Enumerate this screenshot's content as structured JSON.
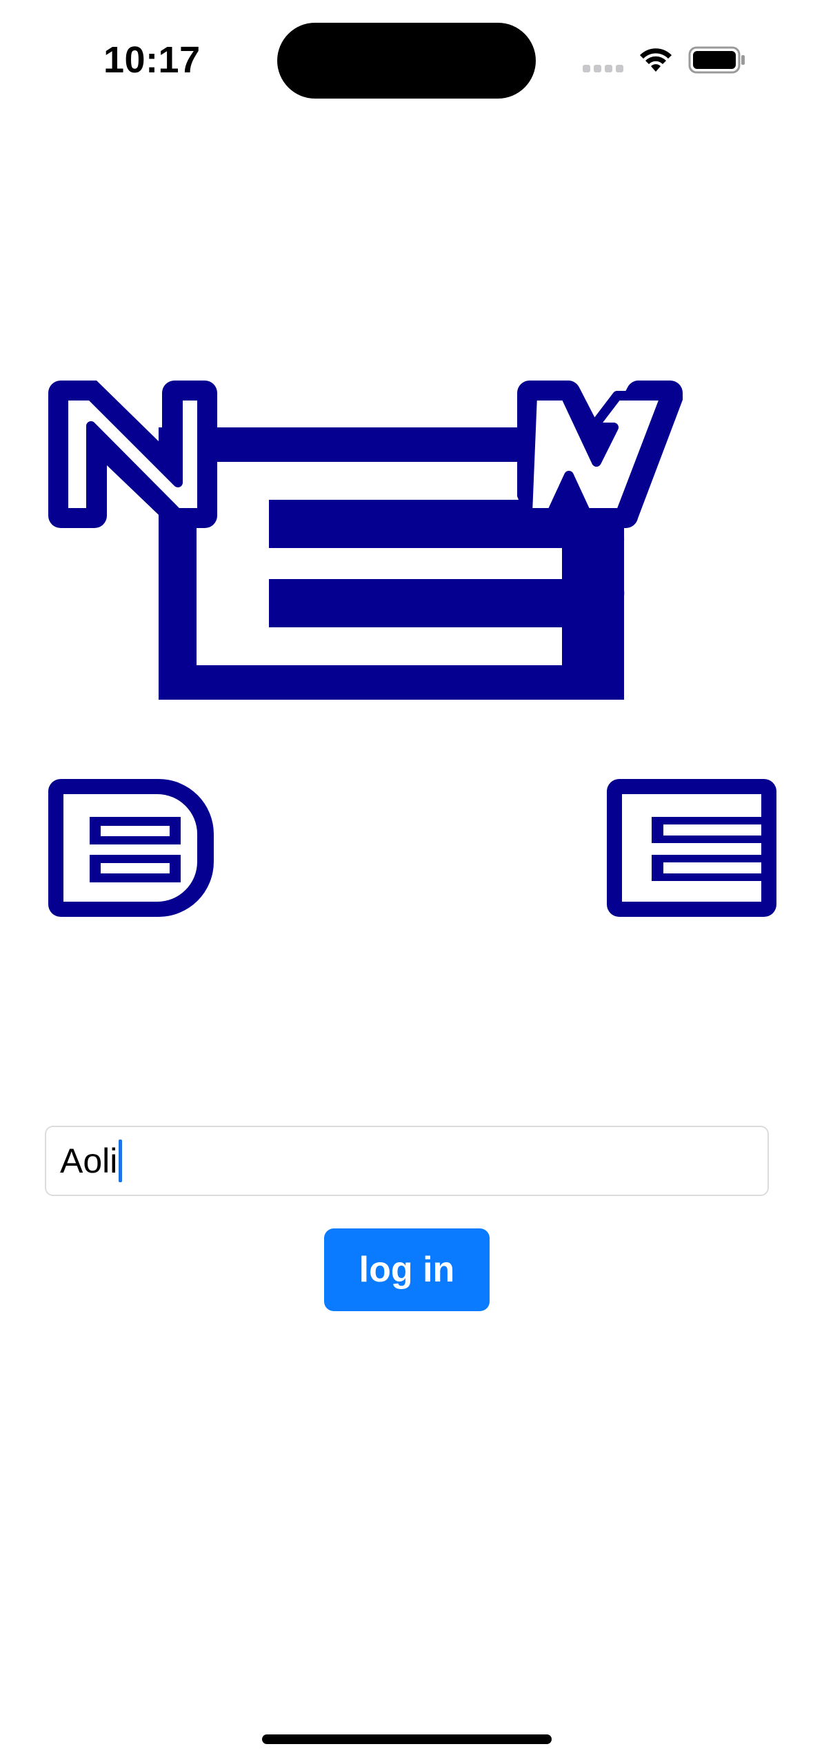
{
  "status_bar": {
    "time": "10:17"
  },
  "logo": {
    "letters": [
      "N",
      "W",
      "B",
      "E"
    ],
    "center_letter": "B",
    "brand_color": "#05008f"
  },
  "login": {
    "name_value": "Aoli",
    "button_label": "log in",
    "button_color": "#0a7bff"
  },
  "icons": {
    "wifi": "wifi-icon",
    "battery": "battery-icon",
    "signal": "cellular-signal-icon"
  }
}
